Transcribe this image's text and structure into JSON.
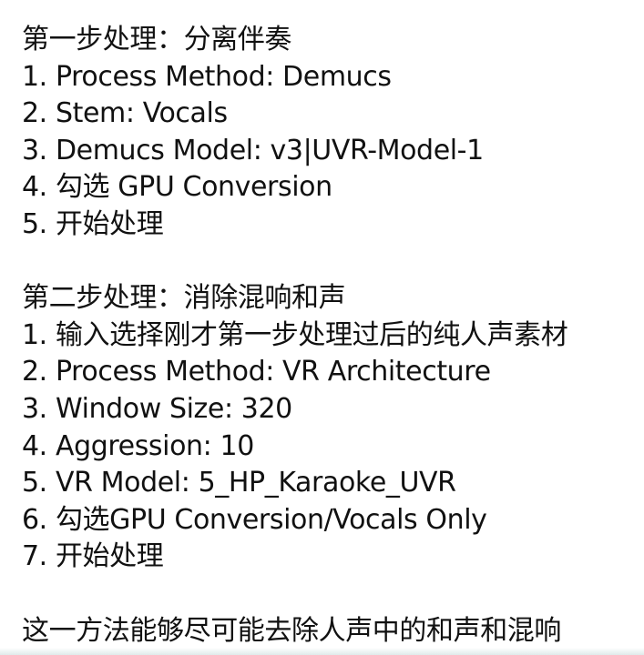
{
  "section1": {
    "heading": "第一步处理：分离伴奏",
    "steps": [
      "1. Process Method: Demucs",
      "2. Stem: Vocals",
      "3. Demucs Model: v3|UVR-Model-1",
      "4. 勾选 GPU Conversion",
      "5. 开始处理"
    ]
  },
  "section2": {
    "heading": "第二步处理：消除混响和声",
    "steps": [
      "1. 输入选择刚才第一步处理过后的纯人声素材",
      "2. Process Method: VR Architecture",
      "3. Window Size: 320",
      "4. Aggression: 10",
      "5. VR Model: 5_HP_Karaoke_UVR",
      "6. 勾选GPU Conversion/Vocals Only",
      "7. 开始处理"
    ]
  },
  "conclusion": "这一方法能够尽可能去除人声中的和声和混响"
}
